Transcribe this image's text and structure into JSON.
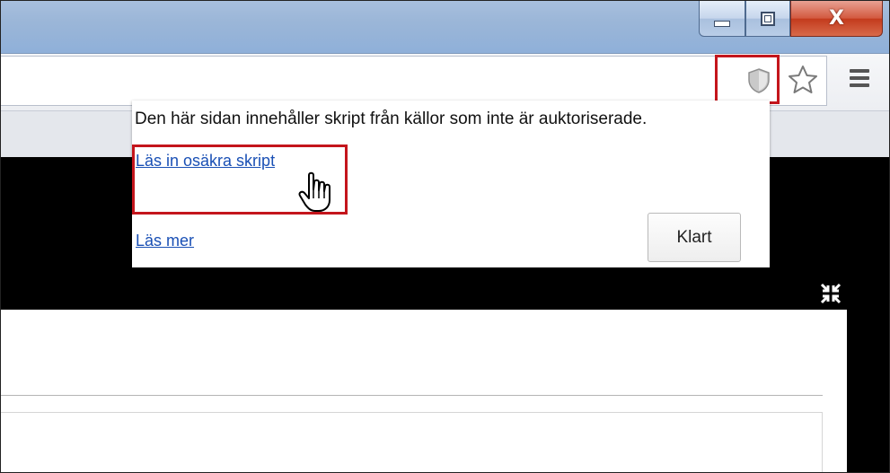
{
  "window": {
    "minimize_icon": "minimize-icon",
    "maximize_icon": "restore-icon",
    "close_glyph": "X"
  },
  "toolbar": {
    "shield_icon": "shield-icon",
    "star_icon": "star-icon",
    "menu_icon": "hamburger-menu-icon"
  },
  "popup": {
    "message": "Den här sidan innehåller skript från källor som inte är auktoriserade.",
    "load_unsafe_link": "Läs in osäkra skript",
    "learn_more_link": "Läs mer",
    "done_button": "Klart"
  },
  "page": {
    "fullscreen_icon": "exit-fullscreen-icon"
  },
  "colors": {
    "highlight": "#c4151c",
    "link": "#1a50b5"
  }
}
